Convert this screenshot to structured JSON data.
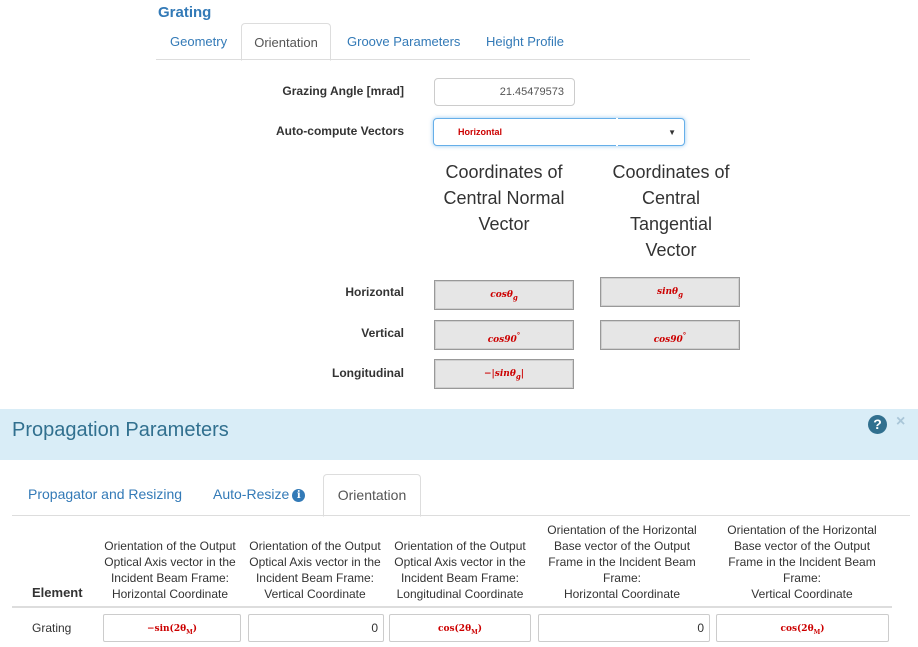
{
  "grating": {
    "title": "Grating",
    "tabs": [
      "Geometry",
      "Orientation",
      "Groove Parameters",
      "Height Profile"
    ],
    "active_tab": "Orientation",
    "grazing_angle": {
      "label": "Grazing Angle [mrad]",
      "value": "21.45479573"
    },
    "auto_compute": {
      "label": "Auto-compute Vectors",
      "selected": "Horizontal"
    },
    "columns": {
      "normal": [
        "Coordinates of",
        "Central Normal",
        "Vector"
      ],
      "tangential": [
        "Coordinates of",
        "Central",
        "Tangential",
        "Vector"
      ]
    },
    "rows": [
      {
        "label": "Horizontal",
        "normal": "cosθ",
        "normal_sub": "g",
        "tangential": "sinθ",
        "tangential_sub": "g"
      },
      {
        "label": "Vertical",
        "normal": "cos90",
        "normal_sup": "°",
        "tangential": "cos90",
        "tangential_sup": "°"
      },
      {
        "label": "Longitudinal",
        "normal": "−|sinθ",
        "normal_sub": "g",
        "normal_tail": "|"
      }
    ]
  },
  "propagation": {
    "title": "Propagation Parameters",
    "help_icon": "question-circle-icon",
    "close_icon": "close-icon",
    "tabs": [
      "Propagator and Resizing",
      "Auto-Resize",
      "Orientation"
    ],
    "active_tab": "Orientation",
    "table": {
      "element_header": "Element",
      "headers": [
        [
          "Orientation of the Output",
          "Optical Axis vector in the",
          "Incident Beam Frame:",
          "Horizontal Coordinate"
        ],
        [
          "Orientation of the Output",
          "Optical Axis vector in the",
          "Incident Beam Frame:",
          "Vertical Coordinate"
        ],
        [
          "Orientation of the Output",
          "Optical Axis vector in the",
          "Incident Beam Frame:",
          "Longitudinal Coordinate"
        ],
        [
          "Orientation of the Horizontal",
          "Base vector of the Output",
          "Frame in the Incident Beam",
          "Frame:",
          "Horizontal Coordinate"
        ],
        [
          "Orientation of the Horizontal",
          "Base vector of the Output",
          "Frame in the Incident Beam",
          "Frame:",
          "Vertical Coordinate"
        ]
      ],
      "row": {
        "label": "Grating",
        "cells": [
          "−sin(2θ",
          "0",
          "cos(2θ",
          "0",
          "cos(2θ"
        ],
        "cell_sub": "M"
      }
    }
  },
  "colors": {
    "link": "#337ab7",
    "formula": "#cc0000",
    "header_bg": "#d9edf7",
    "header_text": "#31708f"
  }
}
